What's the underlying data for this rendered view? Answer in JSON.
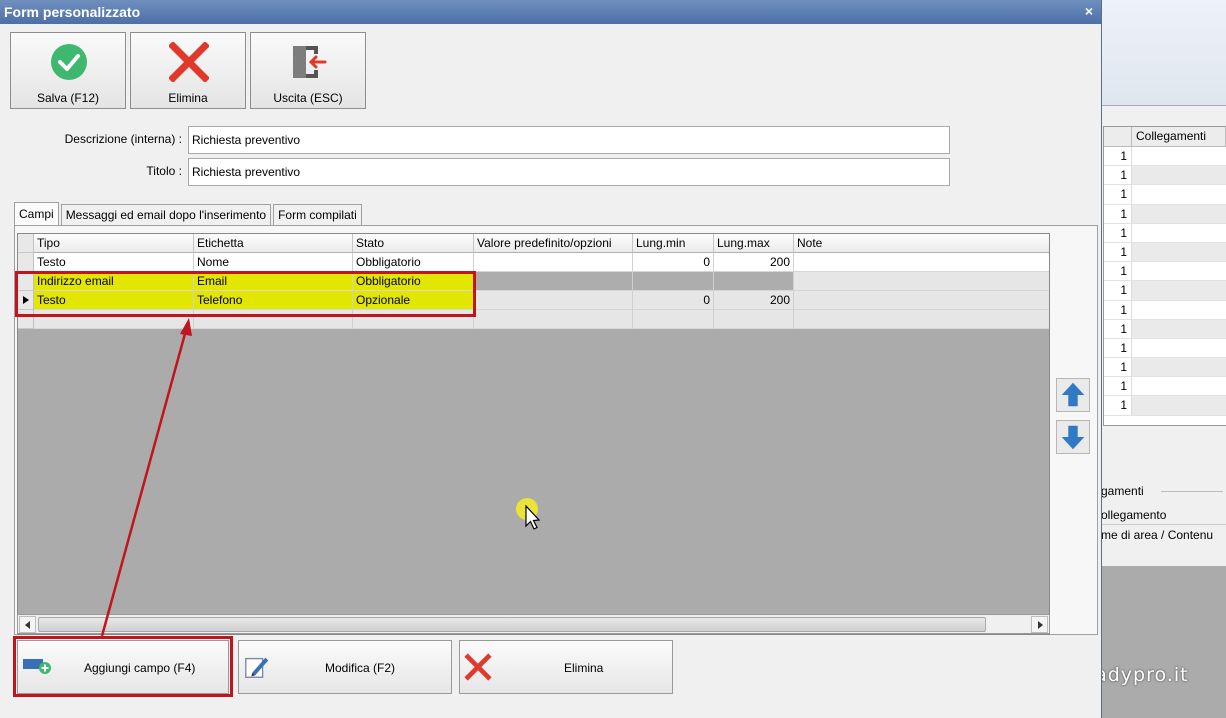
{
  "dialog": {
    "title": "Form personalizzato",
    "close_glyph": "×"
  },
  "toolbar": {
    "save": {
      "label": "Salva (F12)",
      "icon": "check-circle-icon",
      "color": "#3fb86f"
    },
    "delete": {
      "label": "Elimina",
      "icon": "x-icon",
      "color": "#e0392b"
    },
    "exit": {
      "label": "Uscita (ESC)",
      "icon": "exit-door-icon"
    }
  },
  "form": {
    "descrizione_label": "Descrizione (interna) :",
    "descrizione_value": "Richiesta preventivo",
    "titolo_label": "Titolo :",
    "titolo_value": "Richiesta preventivo"
  },
  "tabs": [
    {
      "label": "Campi",
      "active": true
    },
    {
      "label": "Messaggi ed email dopo l'inserimento",
      "active": false
    },
    {
      "label": "Form compilati",
      "active": false
    }
  ],
  "grid": {
    "columns": [
      "Tipo",
      "Etichetta",
      "Stato",
      "Valore predefinito/opzioni",
      "Lung.min",
      "Lung.max",
      "Note"
    ],
    "rows": [
      {
        "tipo": "Testo",
        "etichetta": "Nome",
        "stato": "Obbligatorio",
        "valore": "",
        "lung_min": "0",
        "lung_max": "200",
        "note": ""
      },
      {
        "tipo": "Indirizzo email",
        "etichetta": "Email",
        "stato": "Obbligatorio",
        "valore": "",
        "lung_min": "",
        "lung_max": "",
        "note": ""
      },
      {
        "tipo": "Testo",
        "etichetta": "Telefono",
        "stato": "Opzionale",
        "valore": "",
        "lung_min": "0",
        "lung_max": "200",
        "note": "",
        "current": true
      }
    ],
    "highlight_color": "#e2e600",
    "annotation_color": "#c0151d"
  },
  "bottom_buttons": {
    "add": {
      "label": "Aggiungi campo (F4)",
      "icon": "add-field-icon"
    },
    "edit": {
      "label": "Modifica (F2)",
      "icon": "edit-pencil-icon"
    },
    "delete": {
      "label": "Elimina",
      "icon": "x-icon"
    }
  },
  "background_app": {
    "column_header": "Collegamenti",
    "row_values": [
      "1",
      "1",
      "1",
      "1",
      "1",
      "1",
      "1",
      "1",
      "1",
      "1",
      "1",
      "1",
      "1",
      "1"
    ],
    "group_label": "gamenti",
    "grid2_header": "ollegamento",
    "grid2_row": "me di area / Contenu"
  },
  "watermark": "readypro.it"
}
